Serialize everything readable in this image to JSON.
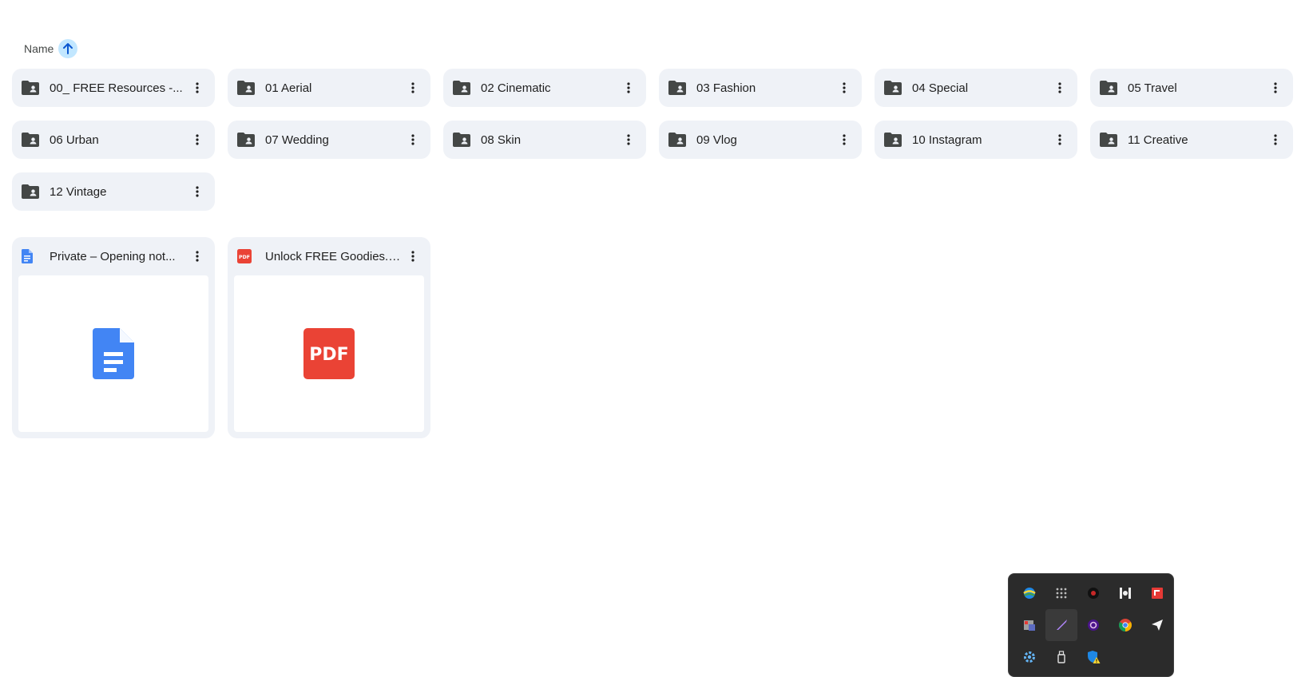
{
  "sort": {
    "label": "Name",
    "direction": "ascending"
  },
  "folders": [
    {
      "name": "00_ FREE Resources -..."
    },
    {
      "name": "01 Aerial"
    },
    {
      "name": "02 Cinematic"
    },
    {
      "name": "03 Fashion"
    },
    {
      "name": "04 Special"
    },
    {
      "name": "05 Travel"
    },
    {
      "name": "06 Urban"
    },
    {
      "name": "07 Wedding"
    },
    {
      "name": "08 Skin"
    },
    {
      "name": "09 Vlog"
    },
    {
      "name": "10 Instagram"
    },
    {
      "name": "11 Creative"
    },
    {
      "name": "12 Vintage"
    }
  ],
  "files": [
    {
      "name": "Private – Opening not...",
      "type": "google-doc",
      "icon": "doc-icon",
      "color": "#4285f4"
    },
    {
      "name": "Unlock FREE Goodies.pdf",
      "type": "pdf",
      "icon": "pdf-icon",
      "color": "#ea4335",
      "thumb_text": "PDF",
      "badge_text": "PDF"
    }
  ],
  "tray": {
    "icons": [
      "globe-sync-icon",
      "dots-grid-icon",
      "dark-circle-app-icon",
      "column-app-icon",
      "red-square-app-icon",
      "device-grid-icon",
      "pen-stylus-icon",
      "purple-circle-app-icon",
      "chrome-icon",
      "send-plane-icon",
      "gear-icon",
      "usb-drive-icon",
      "shield-warning-icon"
    ],
    "active_index": 6
  }
}
